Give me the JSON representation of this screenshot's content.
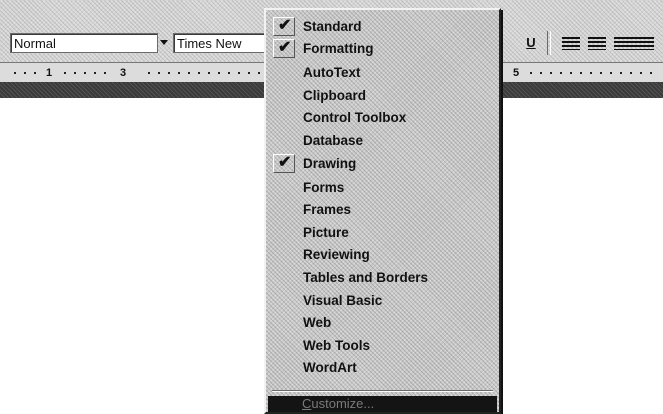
{
  "toolbar": {
    "style_value": "Normal",
    "font_value": "Times New",
    "underline_label": "U",
    "icons": [
      "dropdown-arrow",
      "underline",
      "align-left",
      "align-center",
      "align-right"
    ]
  },
  "ruler": {
    "labels": [
      "1",
      "3",
      "5"
    ]
  },
  "menu": {
    "items": [
      {
        "label": "Standard",
        "checked": true
      },
      {
        "label": "Formatting",
        "checked": true
      },
      {
        "label": "AutoText",
        "checked": false
      },
      {
        "label": "Clipboard",
        "checked": false
      },
      {
        "label": "Control Toolbox",
        "checked": false
      },
      {
        "label": "Database",
        "checked": false
      },
      {
        "label": "Drawing",
        "checked": true
      },
      {
        "label": "Forms",
        "checked": false
      },
      {
        "label": "Frames",
        "checked": false
      },
      {
        "label": "Picture",
        "checked": false
      },
      {
        "label": "Reviewing",
        "checked": false
      },
      {
        "label": "Tables and Borders",
        "checked": false
      },
      {
        "label": "Visual Basic",
        "checked": false
      },
      {
        "label": "Web",
        "checked": false
      },
      {
        "label": "Web Tools",
        "checked": false
      },
      {
        "label": "WordArt",
        "checked": false
      }
    ],
    "check_glyph": "✔",
    "customize": {
      "label_first": "C",
      "label_rest": "ustomize..."
    }
  }
}
